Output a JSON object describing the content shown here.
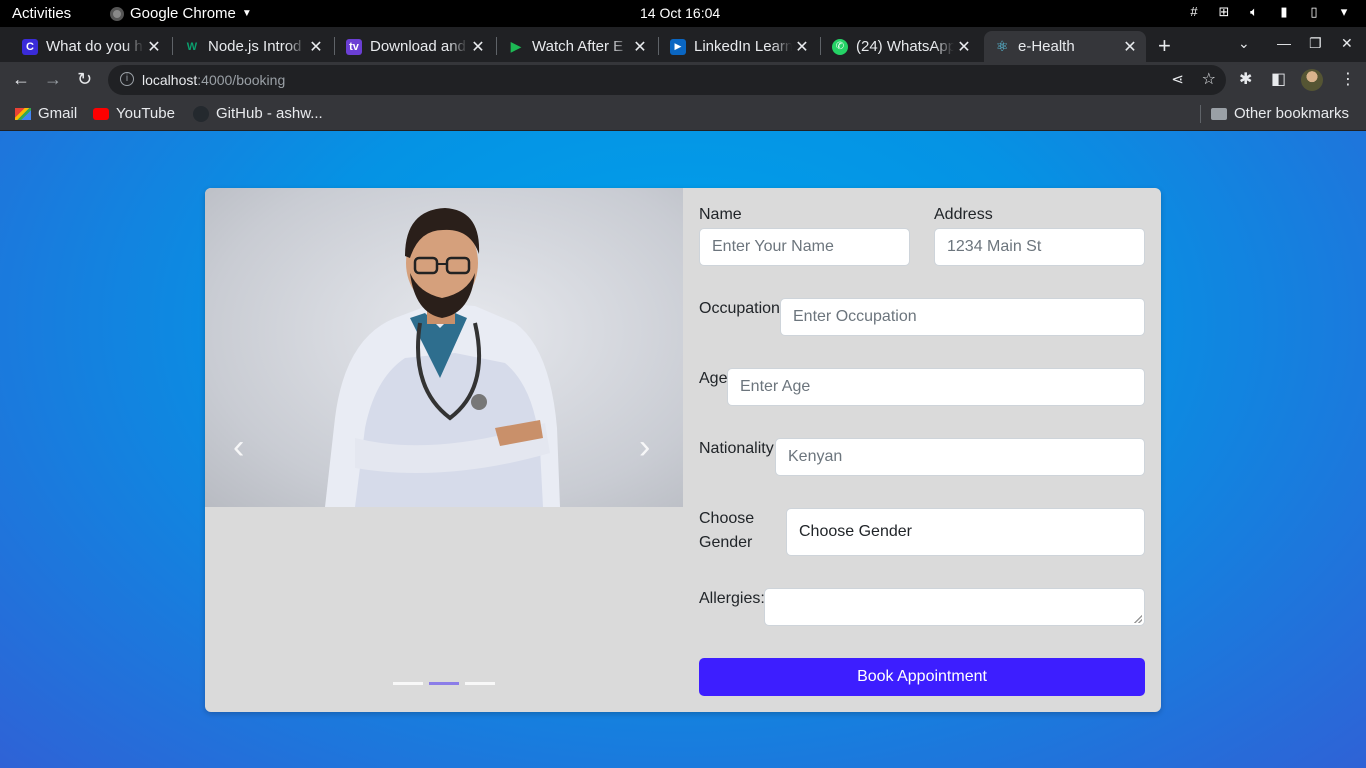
{
  "system_bar": {
    "activities": "Activities",
    "app_name": "Google Chrome",
    "clock": "14 Oct  16:04"
  },
  "tabs": [
    {
      "title": "What do you h",
      "favicon": "C",
      "color": "#3a2bd9"
    },
    {
      "title": "Node.js Introd",
      "favicon": "W",
      "color": "#0aa06e"
    },
    {
      "title": "Download and",
      "favicon": "tv",
      "color": "#6b3fd4"
    },
    {
      "title": "Watch After E",
      "favicon": "▶",
      "color": "#1db954"
    },
    {
      "title": "LinkedIn Learn",
      "favicon": "▶",
      "color": "#0a66c2"
    },
    {
      "title": "(24) WhatsApp",
      "favicon": "✆",
      "color": "#25d366"
    },
    {
      "title": "e-Health",
      "favicon": "⚛",
      "color": "#61dafb"
    }
  ],
  "address_bar": {
    "host": "localhost",
    "path": ":4000/booking"
  },
  "bookmarks": {
    "items": [
      "Gmail",
      "YouTube",
      "GitHub - ashw..."
    ],
    "other": "Other bookmarks"
  },
  "carousel": {
    "prev_label": "‹",
    "next_label": "›",
    "active_indicator": 2,
    "indicator_count": 3
  },
  "form": {
    "name_label": "Name",
    "name_placeholder": "Enter Your Name",
    "address_label": "Address",
    "address_placeholder": "1234 Main St",
    "occupation_label": "Occupation",
    "occupation_placeholder": "Enter Occupation",
    "age_label": "Age",
    "age_placeholder": "Enter Age",
    "nationality_label": "Nationality",
    "nationality_placeholder": "Kenyan",
    "gender_label_line1": "Choose",
    "gender_label_line2": "Gender",
    "gender_value": "Choose Gender",
    "allergies_label": "Allergies:",
    "submit_label": "Book Appointment"
  },
  "colors": {
    "primary_button": "#3d1eff",
    "page_background": "#0593e4",
    "card_background": "#dadada"
  }
}
